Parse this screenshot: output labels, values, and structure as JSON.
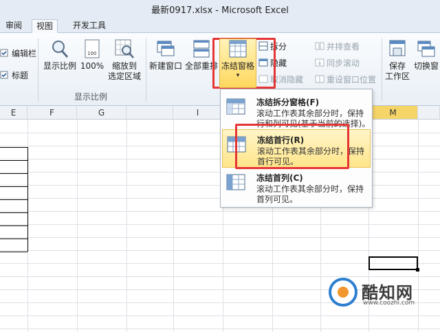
{
  "window": {
    "title": "最新0917.xlsx  -  Microsoft Excel"
  },
  "tabs": [
    {
      "label": "审阅",
      "active": false
    },
    {
      "label": "视图",
      "active": true
    },
    {
      "label": "开发工具",
      "active": false
    }
  ],
  "ribbon": {
    "left_checks": [
      "编辑栏",
      "标题"
    ],
    "group_zoom": {
      "label": "显示比例",
      "buttons": [
        "显示比例",
        "100%",
        "缩放到",
        "选定区域"
      ]
    },
    "window_group": {
      "new_window": "新建窗口",
      "arrange_all": "全部重排",
      "freeze_panes": "冻结窗格",
      "split": "拆分",
      "hide": "隐藏",
      "unhide": "取消隐藏",
      "view_side_by_side": "并排查看",
      "sync_scroll": "同步滚动",
      "reset_position": "重设窗口位置",
      "save_workspace_1": "保存",
      "save_workspace_2": "工作区",
      "switch_window": "切换窗"
    }
  },
  "columns": [
    "E",
    "F",
    "G",
    "I",
    "M"
  ],
  "menu": {
    "items": [
      {
        "title": "冻结拆分窗格(F)",
        "desc": "滚动工作表其余部分时，保持行和列可见(基于当前的选择)。",
        "highlighted": false
      },
      {
        "title": "冻结首行(R)",
        "desc": "滚动工作表其余部分时，保持首行可见。",
        "highlighted": true
      },
      {
        "title": "冻结首列(C)",
        "desc": "滚动工作表其余部分时，保持首列可见。",
        "highlighted": false
      }
    ]
  },
  "watermark": {
    "title": "酷知网",
    "url": "www.coozhi.com"
  },
  "colors": {
    "highlight": "#ffe58a",
    "red_box": "#e63434",
    "accent": "#2d7fd0"
  }
}
